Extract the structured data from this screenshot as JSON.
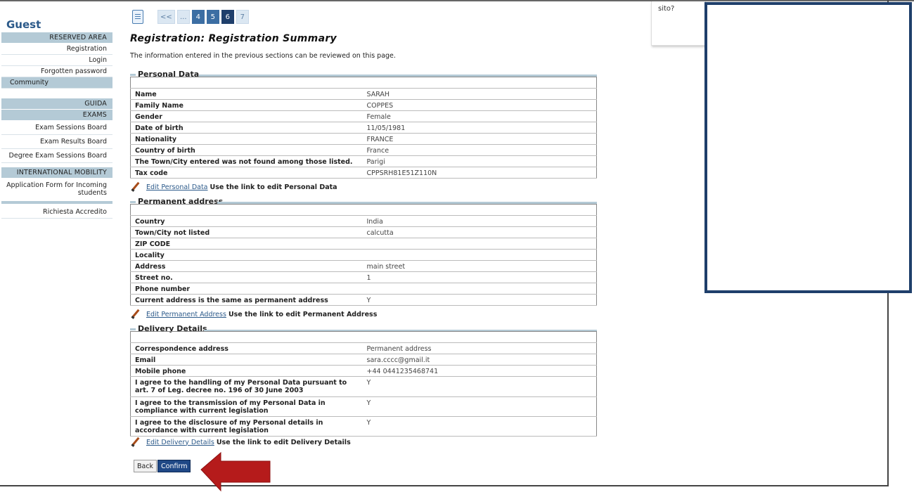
{
  "sidebar": {
    "guest": "Guest",
    "reserved_area": "RESERVED AREA",
    "registration": "Registration",
    "login": "Login",
    "forgotten_password": "Forgotten password",
    "community": "Community",
    "guida": "GUIDA",
    "exams": "EXAMS",
    "exam_sessions_board": "Exam Sessions Board",
    "exam_results_board": "Exam Results Board",
    "degree_exam_sessions_board": "Degree Exam Sessions Board",
    "international_mobility": "INTERNATIONAL MOBILITY",
    "application_form_line1": "Application Form for Incoming",
    "application_form_line2": "students",
    "richiesta_accredito": "Richiesta Accredito"
  },
  "pager": {
    "first": "<<",
    "ellipsis": "...",
    "p4": "4",
    "p5": "5",
    "p6": "6",
    "p7": "7"
  },
  "page": {
    "title": "Registration: Registration Summary",
    "intro": "The information entered in the previous sections can be reviewed on this page."
  },
  "personal": {
    "title": "Personal Data",
    "rows": [
      {
        "label": "Name",
        "value": "SARAH"
      },
      {
        "label": "Family Name",
        "value": "COPPES"
      },
      {
        "label": "Gender",
        "value": "Female"
      },
      {
        "label": "Date of birth",
        "value": "11/05/1981"
      },
      {
        "label": "Nationality",
        "value": "FRANCE"
      },
      {
        "label": "Country of birth",
        "value": "France"
      },
      {
        "label": "The Town/City entered was not found among those listed.",
        "value": "Parigi"
      },
      {
        "label": "Tax code",
        "value": "CPPSRH81E51Z110N"
      }
    ],
    "edit_link": "Edit Personal Data",
    "edit_note": "Use the link to edit Personal Data"
  },
  "permanent": {
    "title": "Permanent address",
    "rows": [
      {
        "label": "Country",
        "value": "India"
      },
      {
        "label": "Town/City not listed",
        "value": "calcutta"
      },
      {
        "label": "ZIP CODE",
        "value": ""
      },
      {
        "label": "Locality",
        "value": ""
      },
      {
        "label": "Address",
        "value": "main street"
      },
      {
        "label": "Street no.",
        "value": "1"
      },
      {
        "label": "Phone number",
        "value": ""
      },
      {
        "label": "Current address is the same as permanent address",
        "value": "Y"
      }
    ],
    "edit_link": "Edit Permanent Address",
    "edit_note": "Use the link to edit Permanent Address"
  },
  "delivery": {
    "title": "Delivery Details",
    "rows": [
      {
        "label": "Correspondence address",
        "value": "Permanent address"
      },
      {
        "label": "Email",
        "value": "sara.cccc@gmail.it"
      },
      {
        "label": "Mobile phone",
        "value": "+44 0441235468741"
      },
      {
        "label": "I agree to the handling of my Personal Data pursuant to art. 7 of Leg. decree no. 196 of 30 June 2003",
        "value": "Y"
      },
      {
        "label": "I agree to the transmission of my Personal Data in compliance with current legislation",
        "value": "Y"
      },
      {
        "label": "I agree to the disclosure of my Personal details in accordance with current legislation",
        "value": "Y"
      }
    ],
    "edit_link": "Edit Delivery Details",
    "edit_note": "Use the link to edit Delivery Details"
  },
  "buttons": {
    "back": "Back",
    "confirm": "Confirm"
  },
  "overlay": {
    "sito": "sito?"
  },
  "colors": {
    "accent": "#1f4886",
    "annotation_red": "#b51b1b",
    "overlay_border": "#1f3f6b"
  }
}
